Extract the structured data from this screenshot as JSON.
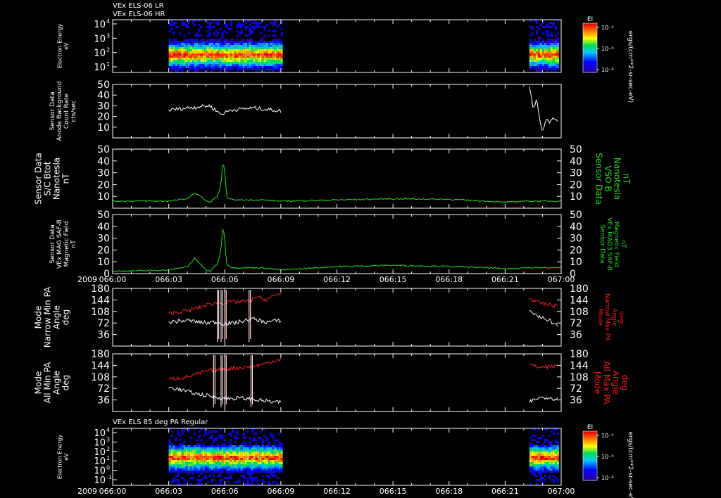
{
  "header_lines": [
    "VEx ELS-06 LR",
    "VEx ELS-06 HR"
  ],
  "bottom_header": "VEx ELS 85 deg PA Regular",
  "year": "2009",
  "x_ticks": [
    "066:00",
    "066:03",
    "066:06",
    "066:09",
    "066:12",
    "066:15",
    "066:18",
    "066:21",
    "067:00"
  ],
  "colors": {
    "white": "#ffffff",
    "green": "#22dd22",
    "red": "#ee2222",
    "background": "#000000"
  },
  "colorbar": {
    "label": "EI",
    "units": "ergs/(cm**2-sr-sec-eV)",
    "ticks": [
      "10⁻⁴",
      "10⁻⁶",
      "10⁻⁸"
    ]
  },
  "chart_data": [
    {
      "type": "heatmap",
      "panel": "energy-spectrogram-top",
      "ylabel_lines": [
        "Electron Energy",
        "eV"
      ],
      "y_ticks": [
        {
          "label": "10",
          "sup": "4"
        },
        {
          "label": "10",
          "sup": "3"
        },
        {
          "label": "10",
          "sup": "2"
        },
        {
          "label": "10",
          "sup": "1"
        }
      ],
      "x_range": [
        "066:00",
        "067:00"
      ],
      "data_intervals": [
        {
          "start": 3.0,
          "end": 9.0
        },
        {
          "start": 22.3,
          "end": 23.8
        }
      ],
      "dark_gaps": [
        {
          "start": 6.0,
          "end": 6.0
        }
      ]
    },
    {
      "type": "line",
      "panel": "anode-background",
      "ylabel_lines": [
        "Sensor Data",
        "Anode Background",
        "Count Rate",
        "cts/sec"
      ],
      "ylim": [
        0,
        50
      ],
      "y_ticks": [
        "50",
        "40",
        "30",
        "20",
        "10"
      ],
      "series": [
        {
          "color": "white",
          "segments": [
            {
              "x_start": 3.0,
              "x_end": 9.0,
              "base": 26,
              "amp": 3,
              "knots": [
                [
                  3.0,
                  26
                ],
                [
                  4.5,
                  29
                ],
                [
                  5.2,
                  30
                ],
                [
                  5.8,
                  22
                ],
                [
                  6.3,
                  26
                ],
                [
                  7.5,
                  28
                ],
                [
                  8.6,
                  26
                ],
                [
                  9.0,
                  25
                ]
              ]
            },
            {
              "x_start": 22.3,
              "x_end": 23.8,
              "knots": [
                [
                  22.3,
                  48
                ],
                [
                  22.5,
                  28
                ],
                [
                  22.7,
                  36
                ],
                [
                  22.9,
                  12
                ],
                [
                  23.0,
                  7
                ],
                [
                  23.2,
                  18
                ],
                [
                  23.4,
                  15
                ],
                [
                  23.6,
                  18
                ],
                [
                  23.8,
                  17
                ]
              ]
            }
          ]
        }
      ]
    },
    {
      "type": "line",
      "panel": "bmag-sc",
      "ylabel_lines": [
        "Sensor Data",
        "S/C Btot",
        "Nanotesla",
        "nT"
      ],
      "ylabel_right_lines": [
        "Sensor Data",
        "VSO B",
        "Nanotesla",
        "nT"
      ],
      "ylim": [
        0,
        50
      ],
      "y_ticks": [
        "50",
        "40",
        "30",
        "20",
        "10"
      ],
      "series": [
        {
          "color": "green",
          "knots": [
            [
              0,
              6
            ],
            [
              3.0,
              6
            ],
            [
              4.0,
              8
            ],
            [
              4.4,
              13
            ],
            [
              4.7,
              10
            ],
            [
              5.0,
              6
            ],
            [
              5.2,
              5
            ],
            [
              5.6,
              10
            ],
            [
              5.8,
              20
            ],
            [
              5.9,
              40
            ],
            [
              6.0,
              30
            ],
            [
              6.1,
              10
            ],
            [
              6.4,
              7
            ],
            [
              8,
              7
            ],
            [
              9,
              6
            ],
            [
              12,
              7
            ],
            [
              15,
              8
            ],
            [
              18,
              7.5
            ],
            [
              20,
              6
            ],
            [
              21,
              5
            ],
            [
              22,
              6
            ],
            [
              24,
              6
            ]
          ]
        }
      ]
    },
    {
      "type": "line",
      "panel": "bmag-saf",
      "ylabel_lines": [
        "Sensor Data",
        "VEx MAG SAF-B",
        "Magnetic Field",
        "nT"
      ],
      "ylabel_right_lines": [
        "Sensor Data",
        "VEx MAG3 SAF-B",
        "Magnetic Field",
        "nT"
      ],
      "ylim": [
        0,
        50
      ],
      "y_ticks": [
        "50",
        "40",
        "30",
        "20",
        "10",
        "0"
      ],
      "series": [
        {
          "color": "green",
          "knots": [
            [
              0,
              2
            ],
            [
              3.0,
              3
            ],
            [
              4.0,
              6
            ],
            [
              4.4,
              13
            ],
            [
              4.7,
              8
            ],
            [
              5.0,
              3
            ],
            [
              5.2,
              2
            ],
            [
              5.6,
              8
            ],
            [
              5.8,
              20
            ],
            [
              5.9,
              42
            ],
            [
              6.0,
              28
            ],
            [
              6.1,
              8
            ],
            [
              6.4,
              5
            ],
            [
              8,
              5
            ],
            [
              9,
              3
            ],
            [
              12,
              6
            ],
            [
              15,
              7
            ],
            [
              18,
              6
            ],
            [
              20,
              5
            ],
            [
              21,
              4
            ],
            [
              22,
              5
            ],
            [
              24,
              5
            ]
          ]
        }
      ]
    },
    {
      "type": "line",
      "panel": "pa-narrow",
      "ylabel_lines": [
        "Mode",
        "Narrow Min PA",
        "Angle",
        "deg"
      ],
      "ylabel_right_lines": [
        "Mode",
        "Narrow Max PA",
        "Angle",
        "deg"
      ],
      "ylim": [
        0,
        180
      ],
      "y_ticks": [
        "180",
        "144",
        "108",
        "72",
        "36"
      ],
      "series": [
        {
          "color": "red",
          "segments": [
            {
              "knots": [
                [
                  3.0,
                  102
                ],
                [
                  4.0,
                  110
                ],
                [
                  5.0,
                  128
                ],
                [
                  5.5,
                  134
                ],
                [
                  6.5,
                  138
                ],
                [
                  7.4,
                  140
                ],
                [
                  7.6,
                  155
                ],
                [
                  8.2,
                  145
                ],
                [
                  9.0,
                  165
                ]
              ]
            },
            {
              "knots": [
                [
                  22.3,
                  148
                ],
                [
                  22.8,
                  135
                ],
                [
                  23.2,
                  130
                ],
                [
                  23.8,
                  125
                ]
              ]
            }
          ],
          "spikes": [
            5.6,
            5.8,
            6.0,
            7.3
          ]
        },
        {
          "color": "white",
          "segments": [
            {
              "knots": [
                [
                  3.0,
                  75
                ],
                [
                  4.0,
                  80
                ],
                [
                  5.0,
                  72
                ],
                [
                  5.5,
                  75
                ],
                [
                  6.0,
                  70
                ],
                [
                  6.5,
                  72
                ],
                [
                  7.5,
                  85
                ],
                [
                  8.2,
                  75
                ],
                [
                  9.0,
                  80
                ]
              ]
            },
            {
              "knots": [
                [
                  22.3,
                  110
                ],
                [
                  22.8,
                  92
                ],
                [
                  23.3,
                  82
                ],
                [
                  23.8,
                  65
                ]
              ]
            }
          ],
          "spikes": [
            5.6,
            5.8,
            6.0,
            7.3
          ]
        }
      ]
    },
    {
      "type": "line",
      "panel": "pa-all",
      "ylabel_lines": [
        "Mode",
        "All Min PA",
        "Angle",
        "deg"
      ],
      "ylabel_right_lines": [
        "Mode",
        "All Max PA",
        "Angle",
        "deg"
      ],
      "ylim": [
        0,
        180
      ],
      "y_ticks": [
        "180",
        "144",
        "108",
        "72",
        "36"
      ],
      "series": [
        {
          "color": "red",
          "segments": [
            {
              "knots": [
                [
                  3.0,
                  100
                ],
                [
                  4.0,
                  108
                ],
                [
                  5.0,
                  125
                ],
                [
                  5.5,
                  130
                ],
                [
                  6.5,
                  135
                ],
                [
                  7.5,
                  140
                ],
                [
                  8.2,
                  150
                ],
                [
                  9.0,
                  165
                ]
              ]
            },
            {
              "knots": [
                [
                  22.3,
                  148
                ],
                [
                  22.6,
                  140
                ],
                [
                  23.0,
                  138
                ],
                [
                  23.8,
                  142
                ]
              ]
            }
          ],
          "spikes": [
            5.4,
            5.8,
            6.0,
            7.4
          ]
        },
        {
          "color": "white",
          "segments": [
            {
              "knots": [
                [
                  3.0,
                  75
                ],
                [
                  3.5,
                  70
                ],
                [
                  4.5,
                  55
                ],
                [
                  5.2,
                  48
                ],
                [
                  6.0,
                  40
                ],
                [
                  6.8,
                  42
                ],
                [
                  7.5,
                  38
                ],
                [
                  8.5,
                  30
                ],
                [
                  9.0,
                  28
                ]
              ]
            },
            {
              "knots": [
                [
                  22.3,
                  30
                ],
                [
                  22.8,
                  42
                ],
                [
                  23.3,
                  45
                ],
                [
                  23.8,
                  38
                ]
              ]
            }
          ],
          "spikes": [
            5.4,
            5.8,
            6.0,
            7.4
          ]
        }
      ]
    },
    {
      "type": "heatmap",
      "panel": "energy-spectrogram-bottom",
      "ylabel_lines": [
        "Electron Energy",
        "eV"
      ],
      "y_ticks": [
        {
          "label": "10",
          "sup": "4"
        },
        {
          "label": "10",
          "sup": "3"
        },
        {
          "label": "10",
          "sup": "2"
        },
        {
          "label": "10",
          "sup": "1"
        },
        {
          "label": "10",
          "sup": "0"
        },
        {
          "label": "10",
          "sup": "-1"
        }
      ],
      "x_range": [
        "066:00",
        "067:00"
      ],
      "data_intervals": [
        {
          "start": 3.0,
          "end": 9.0
        },
        {
          "start": 22.3,
          "end": 23.8
        }
      ]
    }
  ]
}
